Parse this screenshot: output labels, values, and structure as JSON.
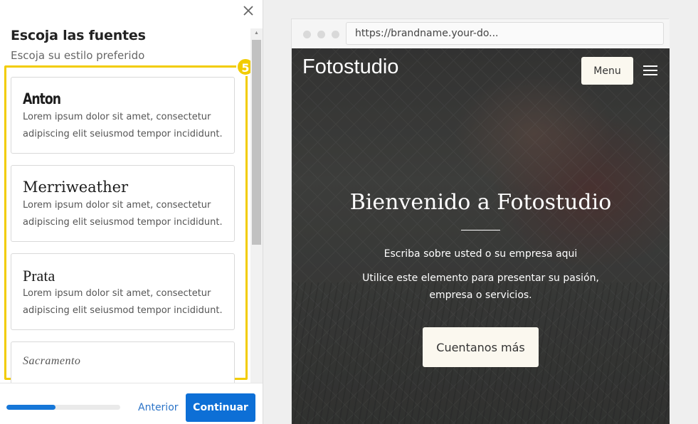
{
  "panel": {
    "title": "Escoja las fuentes",
    "subtitle": "Escoja su estilo preferido",
    "step_badge": "5",
    "font_cards": [
      {
        "name": "Anton",
        "sample": "Lorem ipsum dolor sit amet, consectetur adipiscing elit seiusmod tempor incididunt."
      },
      {
        "name": "Merriweather",
        "sample": "Lorem ipsum dolor sit amet, consectetur adipiscing elit seiusmod tempor incididunt."
      },
      {
        "name": "Prata",
        "sample": "Lorem ipsum dolor sit amet, consectetur adipiscing elit seiusmod tempor incididunt."
      },
      {
        "name": "Sacramento",
        "sample": ""
      }
    ],
    "footer": {
      "progress_fraction": 0.43,
      "previous_label": "Anterior",
      "continue_label": "Continuar"
    }
  },
  "preview": {
    "url": "https://brandname.your-do...",
    "site": {
      "logo": "Fotostudio",
      "menu_label": "Menu",
      "hero_title": "Bienvenido a Fotostudio",
      "hero_lead": "Escriba sobre usted o su empresa aqui",
      "hero_description": "Utilice este elemento para presentar su pasión, empresa o servicios.",
      "cta_label": "Cuentanos más"
    }
  },
  "colors": {
    "highlight": "#f2cc00",
    "primary": "#0d6fd6",
    "link": "#2b73c7",
    "cream": "#fbf8ef"
  }
}
